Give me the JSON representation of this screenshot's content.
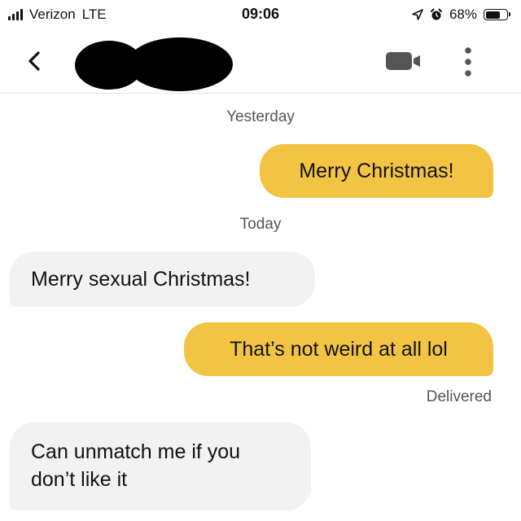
{
  "status_bar": {
    "carrier": "Verizon",
    "network": "LTE",
    "time": "09:06",
    "battery": "68%",
    "battery_level": 0.68,
    "icons": [
      "signal-icon",
      "location-arrow-icon",
      "alarm-icon",
      "battery-icon"
    ]
  },
  "header": {
    "back_icon": "chevron-left-icon",
    "contact_name_redacted": true,
    "video_icon": "video-camera-icon",
    "more_icon": "more-vertical-icon"
  },
  "conversation": {
    "day1_label": "Yesterday",
    "msg1": "Merry Christmas!",
    "day2_label": "Today",
    "msg2": "Merry sexual Christmas!",
    "msg3": "That’s not weird at all lol",
    "delivered": "Delivered",
    "msg4_line1": "Can unmatch me if you",
    "msg4_line2": "don’t like it"
  },
  "colors": {
    "outgoing_bubble": "#f3c444",
    "incoming_bubble": "#f2f2f2",
    "meta_text": "#555555"
  }
}
